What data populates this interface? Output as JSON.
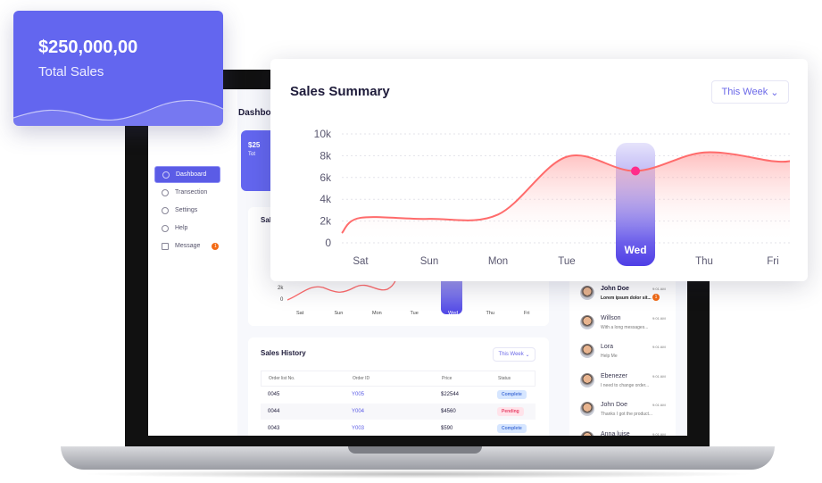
{
  "total_sales": {
    "amount": "$250,000,00",
    "label": "Total Sales",
    "color": "#6366ef"
  },
  "sales_summary": {
    "title": "Sales Summary",
    "filter": "This Week",
    "highlight_day": "Wed",
    "accent": "#ff6b6b",
    "highlight_color": "#5b4cf0"
  },
  "chart_data": {
    "type": "area",
    "title": "Sales Summary",
    "categories": [
      "Sat",
      "Sun",
      "Mon",
      "Tue",
      "Wed",
      "Thu",
      "Fri"
    ],
    "series": [
      {
        "values": [
          2300,
          2200,
          2600,
          7900,
          6600,
          8300,
          7500
        ]
      }
    ],
    "y_ticks": [
      "10k",
      "8k",
      "6k",
      "4k",
      "2k",
      "0"
    ],
    "ylim": [
      0,
      10000
    ],
    "grid": true,
    "highlight": "Wed"
  },
  "dashboard": {
    "header": "Dashboard",
    "mini_card": {
      "amount": "$25",
      "label": "Tot"
    },
    "sidebar": [
      {
        "label": "Dashboard",
        "icon": "cube-icon",
        "active": true
      },
      {
        "label": "Transection",
        "icon": "globe-icon"
      },
      {
        "label": "Settings",
        "icon": "gear-icon"
      },
      {
        "label": "Help",
        "icon": "help-icon"
      },
      {
        "label": "Message",
        "icon": "mail-icon",
        "badge": "1"
      }
    ],
    "summary_stub": {
      "title": "Sal",
      "y_ticks": [
        "2k",
        "0"
      ],
      "days": [
        "Sat",
        "Sun",
        "Mon",
        "Tue",
        "Wed",
        "Thu",
        "Fri"
      ]
    },
    "sales_history": {
      "title": "Sales History",
      "filter": "This Week",
      "columns": [
        "Order list No.",
        "Order ID",
        "Price",
        "Status"
      ],
      "rows": [
        {
          "no": "0045",
          "id": "Y005",
          "price": "$22544",
          "status": "Complete"
        },
        {
          "no": "0044",
          "id": "Y004",
          "price": "$4560",
          "status": "Pending"
        },
        {
          "no": "0043",
          "id": "Y003",
          "price": "$590",
          "status": "Complete"
        }
      ]
    },
    "messages": [
      {
        "name": "John Doe",
        "text": "Lorem ipsum dolor sit...",
        "time": "9:01 AM",
        "badge": "1",
        "unread": true
      },
      {
        "name": "Willson",
        "text": "With a long messages...",
        "time": "9:01 AM"
      },
      {
        "name": "Lora",
        "text": "Help Me",
        "time": "9:01 AM"
      },
      {
        "name": "Ebenezer",
        "text": "I need to change order...",
        "time": "9:01 AM"
      },
      {
        "name": "John Doe",
        "text": "Thanks I got the product...",
        "time": "9:01 AM"
      },
      {
        "name": "Anna luise",
        "text": "",
        "time": "9:01 AM"
      }
    ]
  }
}
